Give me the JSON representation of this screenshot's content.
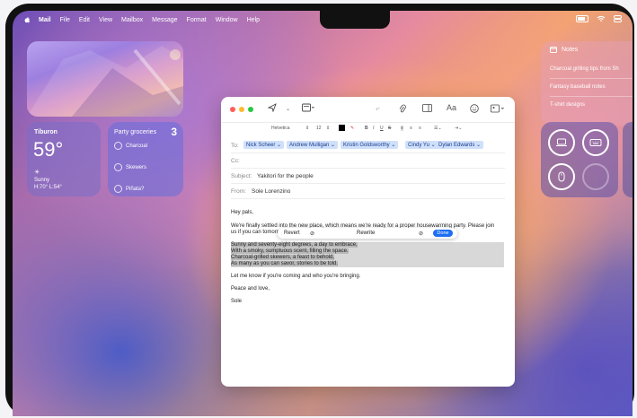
{
  "menubar": {
    "app": "Mail",
    "items": [
      "File",
      "Edit",
      "View",
      "Mailbox",
      "Message",
      "Format",
      "Window",
      "Help"
    ]
  },
  "weather": {
    "city": "Tiburon",
    "temp": "59°",
    "condition": "Sunny",
    "range": "H:70° L:54°"
  },
  "reminders": {
    "title": "Party groceries",
    "count": "3",
    "items": [
      "Charcoal",
      "Skewers",
      "Piñata?"
    ]
  },
  "notes": {
    "title": "Notes",
    "items": [
      "Charcoal grilling tips from Sh",
      "Fantasy baseball notes",
      "T-shirt designs"
    ]
  },
  "compose": {
    "format": {
      "font": "Helvetica",
      "size": "12"
    },
    "to_label": "To:",
    "recipients": [
      "Nick Scheer",
      "Andrew Mulligan",
      "Kristin Goldsworthy",
      "Cindy Yu",
      "Dylan Edwards"
    ],
    "cc_label": "Cc:",
    "subject_label": "Subject:",
    "subject": "Yakitori for the people",
    "from_label": "From:",
    "from": "Sole Lorenzino",
    "greeting": "Hey pals,",
    "para1_line1": "We're finally settled into the new place, which means we're ready for a proper housewarming party. Please join",
    "para1_line2": "us if you can tomorrow",
    "poem": [
      "Sunny and seventy-eight degrees, a day to embrace,",
      "With a smoky, sumptuous scent, filling the space.",
      "Charcoal-grilled skewers, a feast to behold,",
      "As many as you can savor, stories to be told."
    ],
    "closing_line": "Let me know if you're coming and who you're bringing.",
    "signoff": "Peace and love,",
    "signature": "Sole"
  },
  "writing_tools": {
    "revert": "Revert",
    "rewrite": "Rewrite",
    "done": "Done"
  },
  "colors": {
    "accent": "#1e6ef2",
    "chip_bg": "#cfe0fb"
  }
}
